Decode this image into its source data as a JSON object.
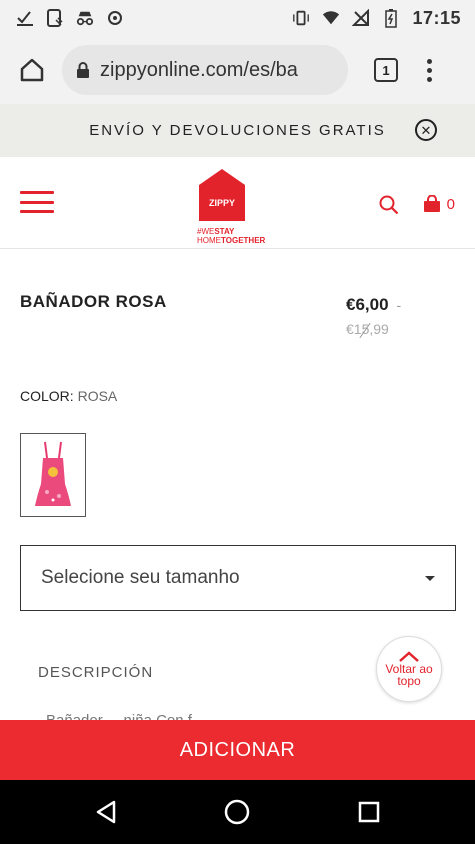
{
  "status_bar": {
    "time": "17:15",
    "icons": [
      "checkmark-icon",
      "screenshot-icon",
      "incognito-icon",
      "sync-icon",
      "vibrate-icon",
      "wifi-icon",
      "no-signal-icon",
      "battery-icon"
    ]
  },
  "browser": {
    "url": "zippyonline.com/es/ba",
    "tab_count": "1"
  },
  "promo": {
    "text": "ENVÍO Y DEVOLUCIONES GRATIS"
  },
  "header": {
    "logo_text": "ZIPPY",
    "tagline_prefix": "#WE",
    "tagline_bold_1": "STAY",
    "tagline_prefix_2": "HOME",
    "tagline_bold_2": "TOGETHER",
    "cart_count": "0"
  },
  "product": {
    "title": "BAÑADOR ROSA",
    "price_now": "€6,00",
    "price_dash": "-",
    "price_old": "€15,99",
    "color_label": "COLOR:",
    "color_value": "ROSA",
    "size_placeholder": "Selecione seu tamanho",
    "description_label": "DESCRIPCIÓN",
    "description_partial": "Bañador ... niña Con f..."
  },
  "back_to_top": {
    "label": "Voltar ao topo"
  },
  "cta": {
    "add_label": "ADICIONAR"
  },
  "colors": {
    "brand_red": "#e3232c",
    "cta_red": "#eb2b30"
  }
}
